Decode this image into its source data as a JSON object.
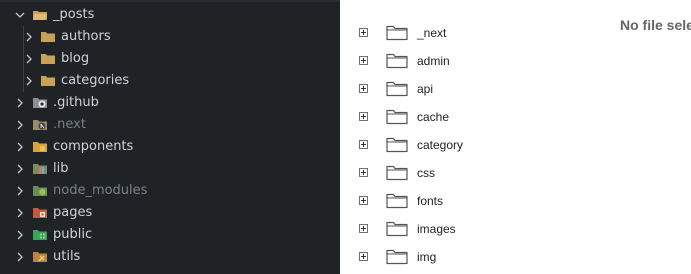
{
  "explorer": {
    "items": [
      {
        "label": "_posts",
        "state": "expanded",
        "icon": "folder-open-icon",
        "level": 0,
        "dim": false
      },
      {
        "label": "authors",
        "state": "collapsed",
        "icon": "folder-icon",
        "level": 1,
        "dim": false
      },
      {
        "label": "blog",
        "state": "collapsed",
        "icon": "folder-icon",
        "level": 1,
        "dim": false
      },
      {
        "label": "categories",
        "state": "collapsed",
        "icon": "folder-icon",
        "level": 1,
        "dim": false
      },
      {
        "label": ".github",
        "state": "collapsed",
        "icon": "github-folder-icon",
        "level": 0,
        "dim": false
      },
      {
        "label": ".next",
        "state": "collapsed",
        "icon": "next-folder-icon",
        "level": 0,
        "dim": true
      },
      {
        "label": "components",
        "state": "collapsed",
        "icon": "components-folder-icon",
        "level": 0,
        "dim": false
      },
      {
        "label": "lib",
        "state": "collapsed",
        "icon": "lib-folder-icon",
        "level": 0,
        "dim": false
      },
      {
        "label": "node_modules",
        "state": "collapsed",
        "icon": "node-folder-icon",
        "level": 0,
        "dim": true
      },
      {
        "label": "pages",
        "state": "collapsed",
        "icon": "pages-folder-icon",
        "level": 0,
        "dim": false
      },
      {
        "label": "public",
        "state": "collapsed",
        "icon": "public-folder-icon",
        "level": 0,
        "dim": false
      },
      {
        "label": "utils",
        "state": "collapsed",
        "icon": "utils-folder-icon",
        "level": 0,
        "dim": false
      }
    ]
  },
  "file_list": {
    "empty_message": "No file sele",
    "folders": [
      "_next",
      "admin",
      "api",
      "cache",
      "category",
      "css",
      "fonts",
      "images",
      "img"
    ]
  },
  "colors": {
    "explorer_bg": "#1f2326",
    "folder_yellow": "#c9a25a"
  }
}
